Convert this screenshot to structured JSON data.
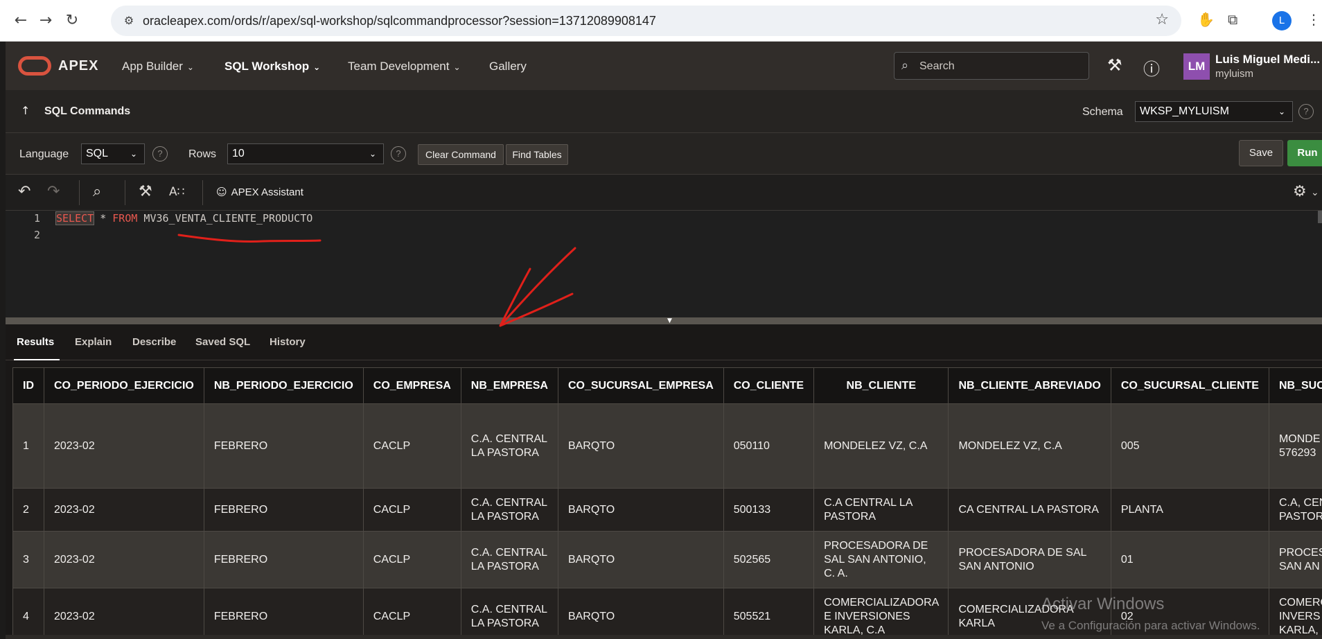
{
  "browser": {
    "url": "oracleapex.com/ords/r/apex/sql-workshop/sqlcommandprocessor?session=13712089908147",
    "profile_initial": "L"
  },
  "header": {
    "brand": "APEX",
    "menus": [
      "App Builder",
      "SQL Workshop",
      "Team Development",
      "Gallery"
    ],
    "search_placeholder": "Search",
    "avatar_initials": "LM",
    "user_name": "Luis Miguel Medi...",
    "workspace": "myluism"
  },
  "commandbar": {
    "title": "SQL Commands",
    "schema_label": "Schema",
    "schema_value": "WKSP_MYLUISM"
  },
  "options": {
    "language_label": "Language",
    "language_value": "SQL",
    "rows_label": "Rows",
    "rows_value": "10",
    "clear_label": "Clear Command",
    "find_label": "Find Tables",
    "save_label": "Save",
    "run_label": "Run"
  },
  "toolbar": {
    "assistant_label": "APEX Assistant"
  },
  "editor": {
    "lines": [
      "1",
      "2"
    ],
    "kw_select": "SELECT",
    "star": " * ",
    "kw_from": "FROM",
    "table_name": " MV36_VENTA_CLIENTE_PRODUCTO"
  },
  "tabs": [
    "Results",
    "Explain",
    "Describe",
    "Saved SQL",
    "History"
  ],
  "results": {
    "columns": [
      "ID",
      "CO_PERIODO_EJERCICIO",
      "NB_PERIODO_EJERCICIO",
      "CO_EMPRESA",
      "NB_EMPRESA",
      "CO_SUCURSAL_EMPRESA",
      "CO_CLIENTE",
      "NB_CLIENTE",
      "NB_CLIENTE_ABREVIADO",
      "CO_SUCURSAL_CLIENTE",
      "NB_SUC"
    ],
    "rows": [
      [
        "1",
        "2023-02",
        "FEBRERO",
        "CACLP",
        "C.A. CENTRAL LA PASTORA",
        "BARQTO",
        "050110",
        "MONDELEZ VZ, C.A",
        "MONDELEZ VZ, C.A",
        "005",
        "MONDE 576293"
      ],
      [
        "2",
        "2023-02",
        "FEBRERO",
        "CACLP",
        "C.A. CENTRAL LA PASTORA",
        "BARQTO",
        "500133",
        "C.A CENTRAL LA PASTORA",
        "CA CENTRAL LA PASTORA",
        "PLANTA",
        "C.A, CEN PASTOR"
      ],
      [
        "3",
        "2023-02",
        "FEBRERO",
        "CACLP",
        "C.A. CENTRAL LA PASTORA",
        "BARQTO",
        "502565",
        "PROCESADORA DE SAL SAN ANTONIO, C. A.",
        "PROCESADORA DE SAL SAN ANTONIO",
        "01",
        "PROCES SAN AN"
      ],
      [
        "4",
        "2023-02",
        "FEBRERO",
        "CACLP",
        "C.A. CENTRAL LA PASTORA",
        "BARQTO",
        "505521",
        "COMERCIALIZADORA E INVERSIONES KARLA, C.A",
        "COMERCIALIZADORA KARLA",
        "02",
        "COMERC INVERS KARLA,"
      ]
    ]
  },
  "watermark": {
    "line1": "Activar Windows",
    "line2": "Ve a Configuración para activar Windows."
  }
}
